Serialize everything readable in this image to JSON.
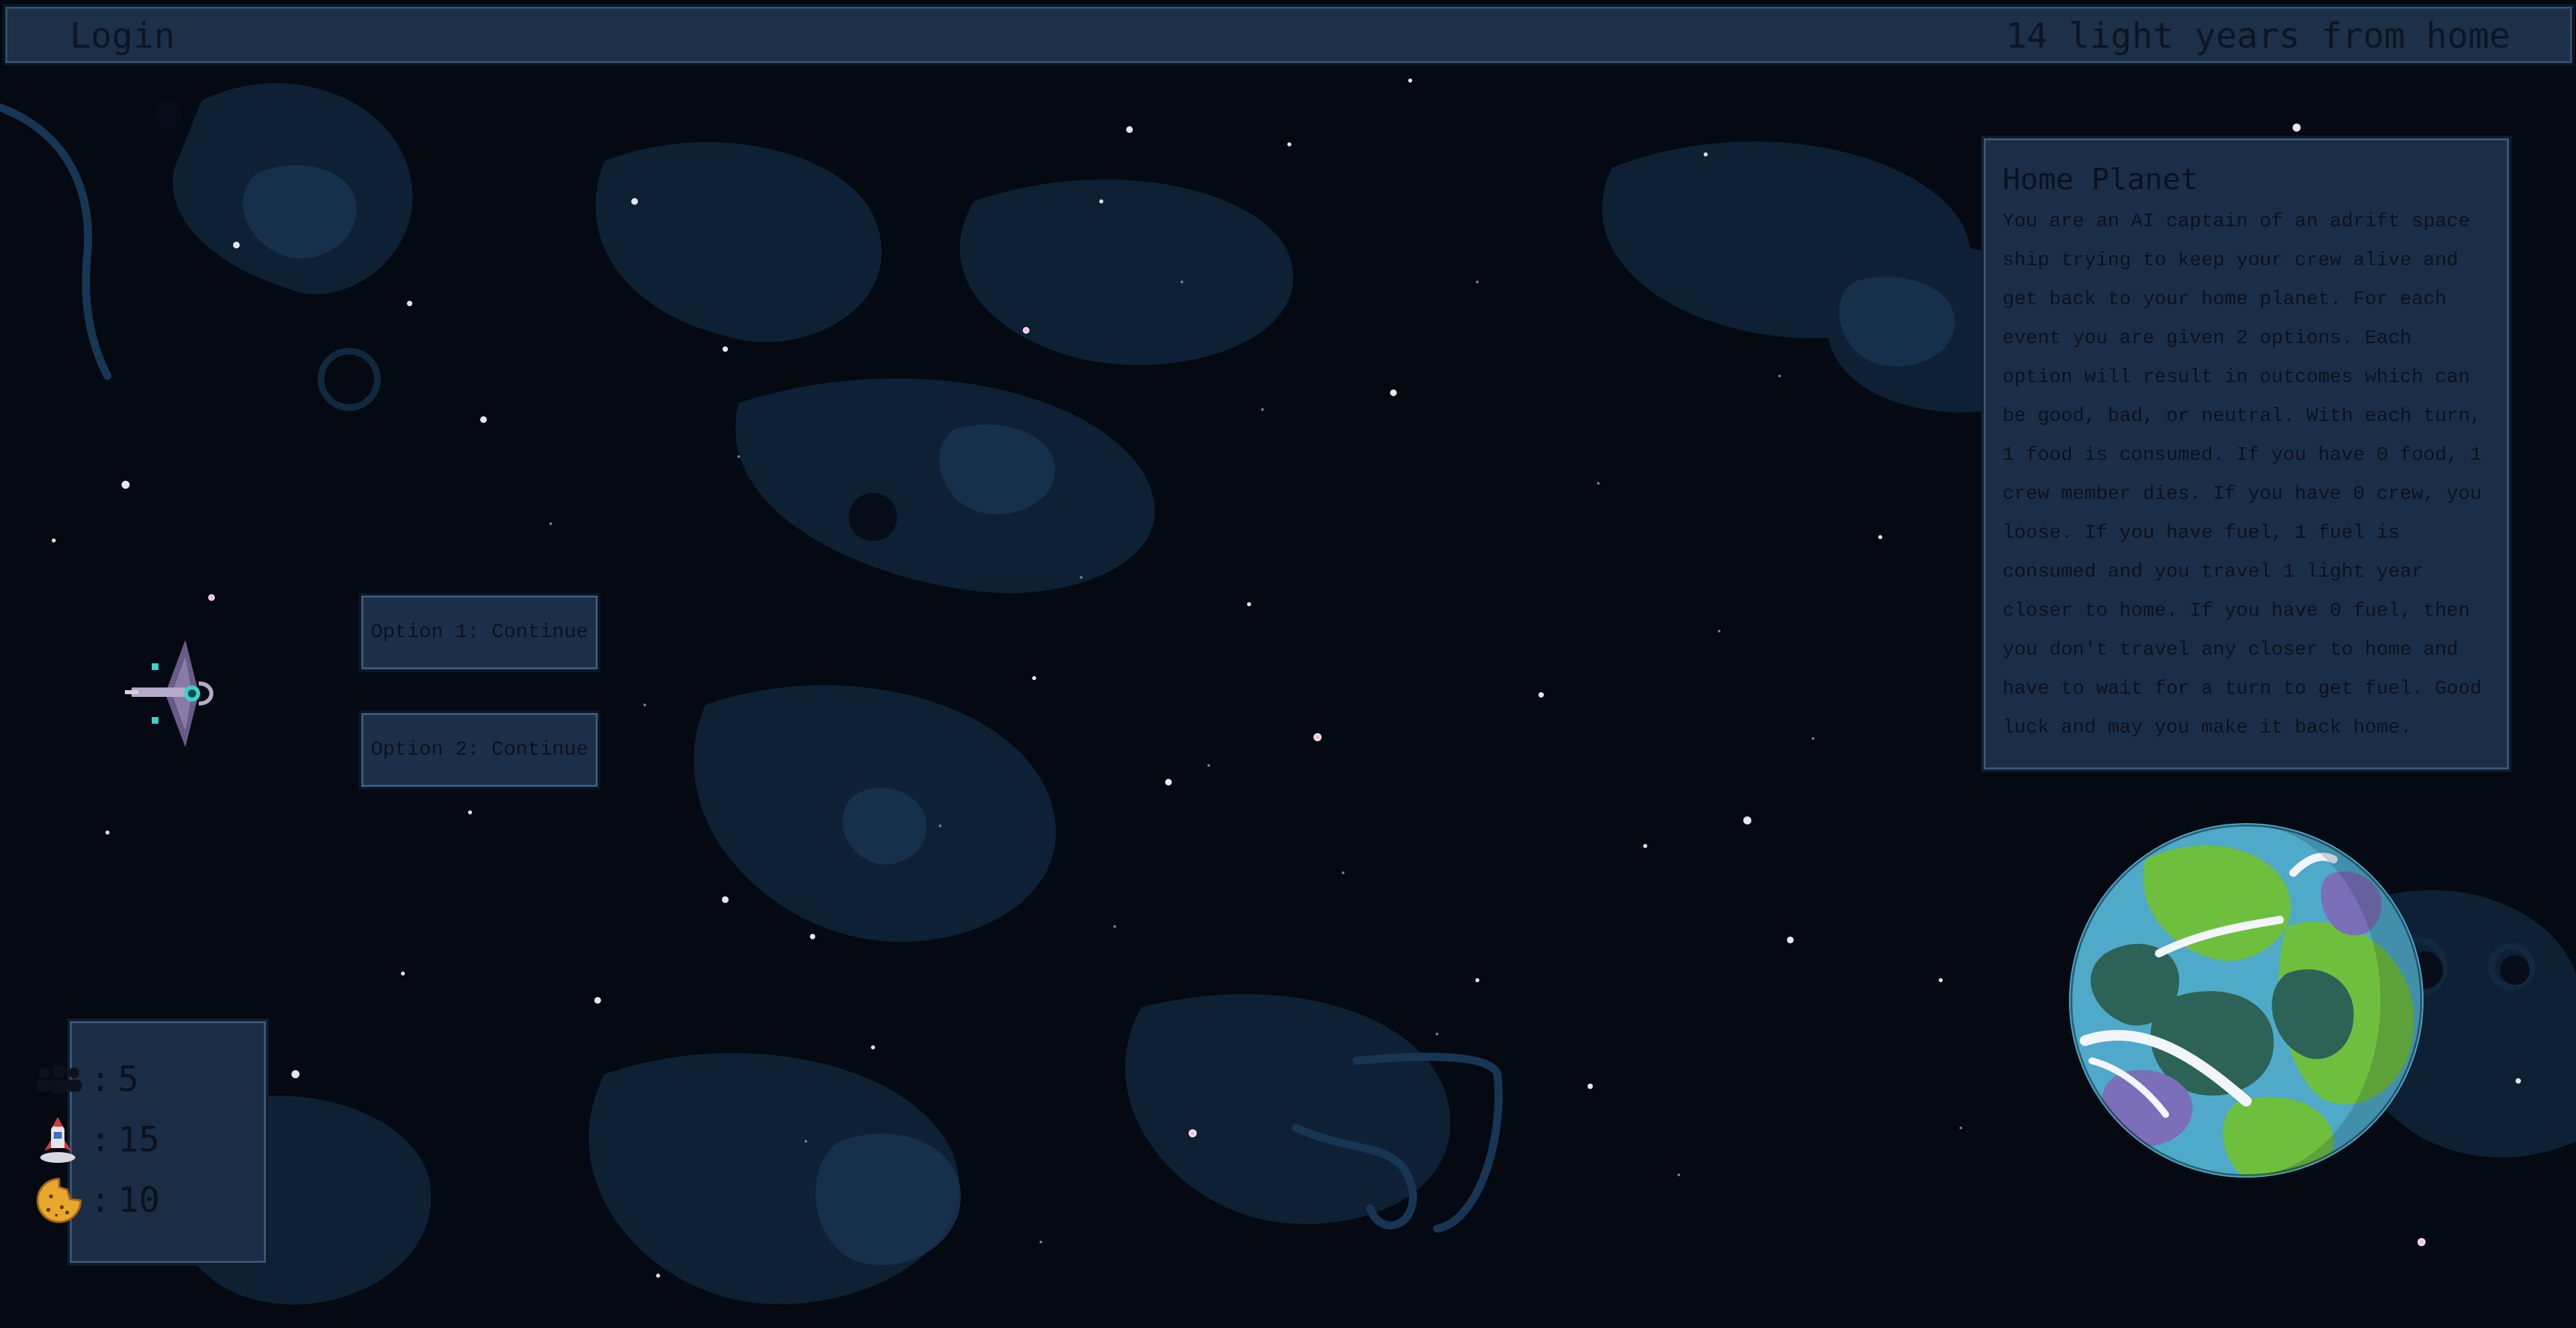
{
  "header": {
    "login_label": "Login",
    "distance_text": "14 light years from home"
  },
  "info_panel": {
    "title": "Home Planet",
    "body": "You are an AI captain of an adrift space ship trying to keep your crew alive and get back to your home planet. For each event you are given 2 options. Each option will result in outcomes which can be good, bad, or neutral. With each turn, 1 food is consumed. If you have 0 food, 1 crew member dies. If you have 0 crew, you loose. If you have fuel, 1 fuel is consumed and you travel 1 light year closer to home. If you have 0 fuel, then you don't travel any closer to home and have to wait for a turn to get fuel. Good luck and may you make it back home."
  },
  "options": [
    {
      "label": "Option 1: Continue"
    },
    {
      "label": "Option 2: Continue"
    }
  ],
  "stats": {
    "crew": {
      "icon": "crew-icon",
      "value": "5"
    },
    "fuel": {
      "icon": "rocket-icon",
      "value": "15"
    },
    "food": {
      "icon": "cookie-icon",
      "value": "10"
    },
    "separator": ":"
  },
  "colors": {
    "space": "#040912",
    "nebula": "#10253c",
    "panel": "#1b2d45",
    "panel_border": "#3a5878",
    "text": "#0b121d"
  }
}
